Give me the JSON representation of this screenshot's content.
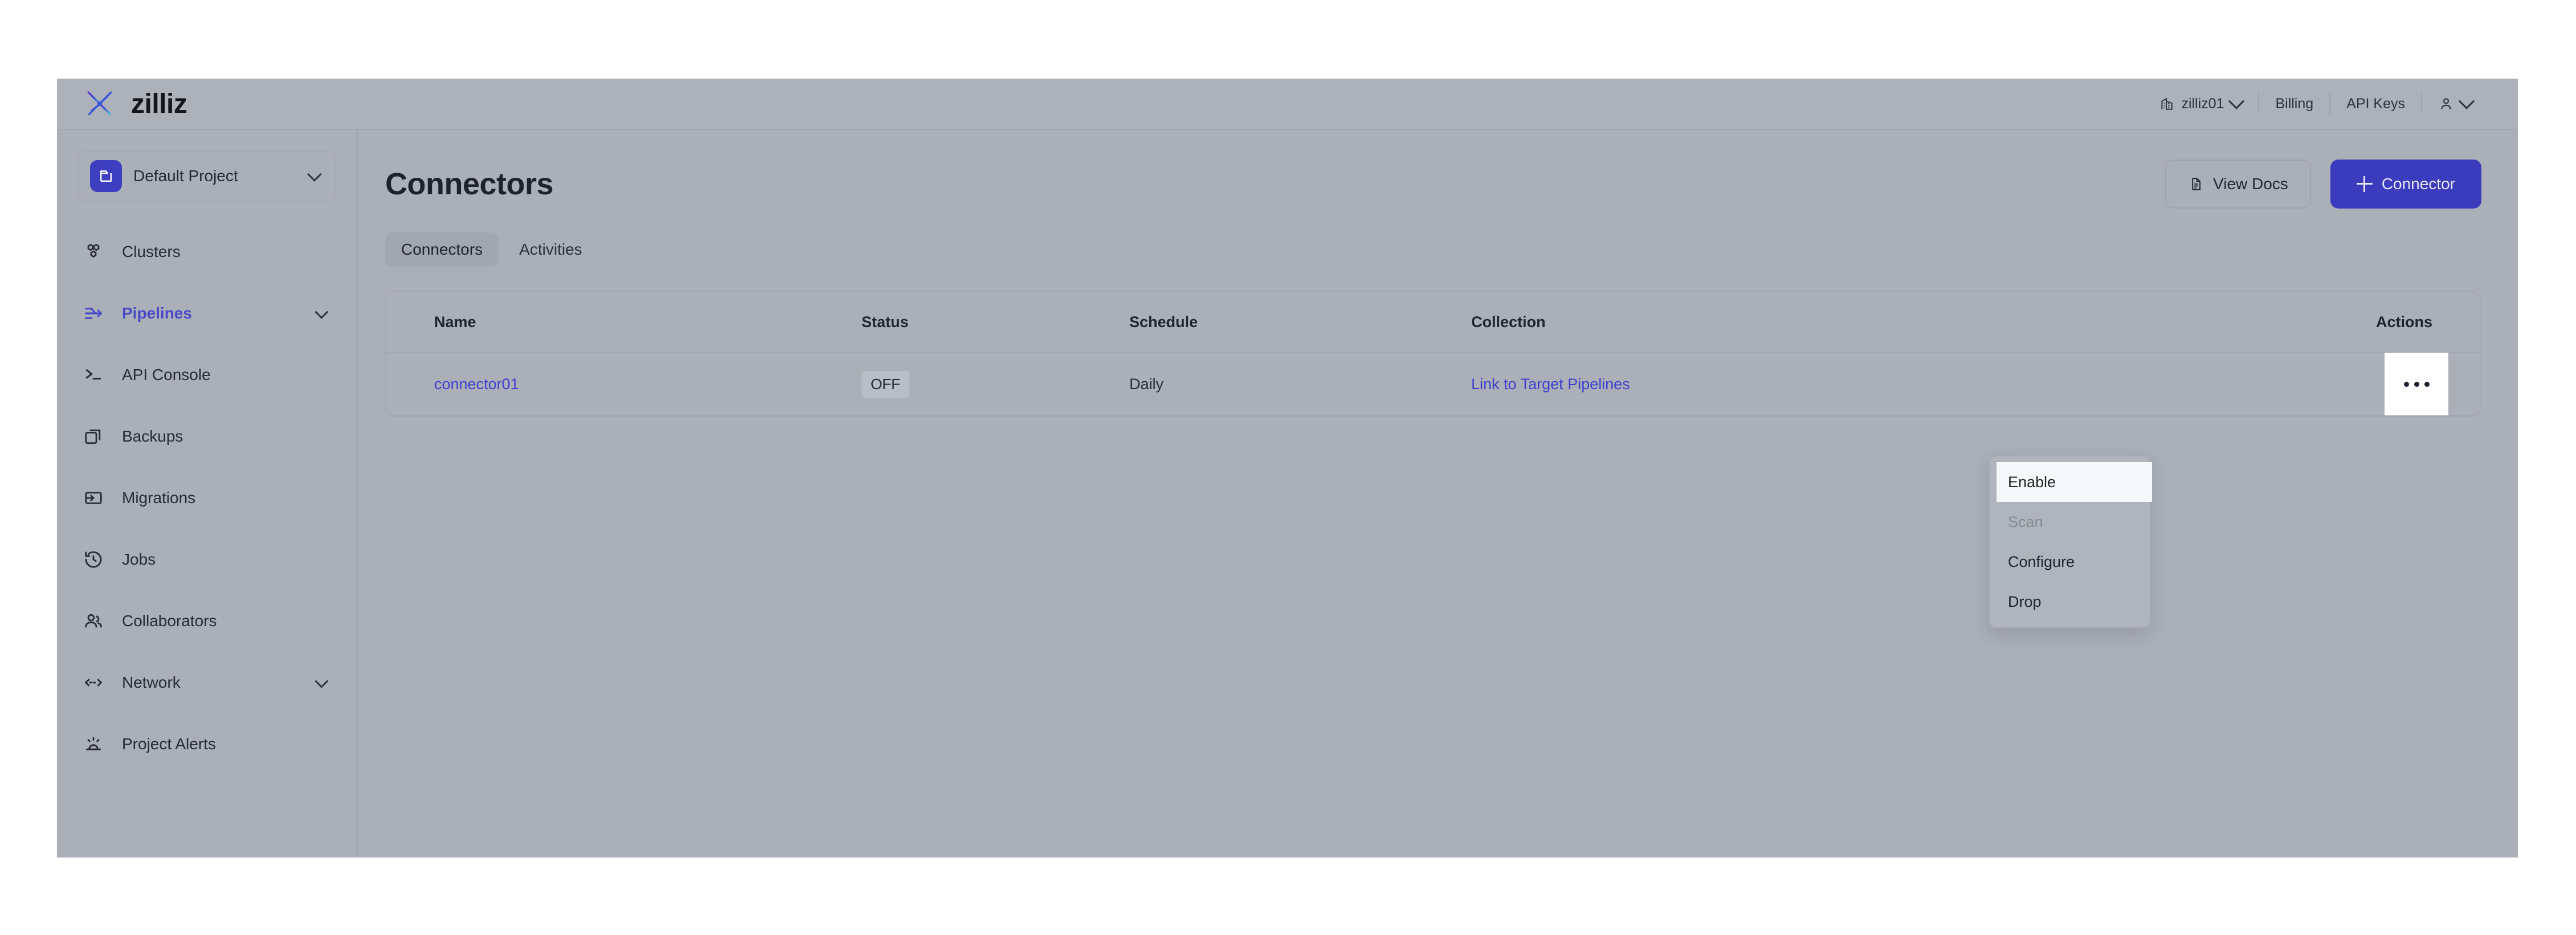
{
  "topbar": {
    "brand": "zilliz",
    "brand_logo_icon": "zilliz-starburst-icon",
    "org": {
      "icon": "building-icon",
      "label": "zilliz01",
      "chevron_icon": "chevron-down-icon"
    },
    "billing_label": "Billing",
    "api_keys_label": "API Keys",
    "account": {
      "icon": "user-icon",
      "chevron_icon": "chevron-down-icon"
    }
  },
  "sidebar": {
    "project": {
      "icon": "folder-icon",
      "label": "Default Project",
      "chevron_icon": "chevron-down-icon"
    },
    "items": [
      {
        "label": "Clusters",
        "icon": "honeycomb-icon",
        "active": false,
        "chevron": false
      },
      {
        "label": "Pipelines",
        "icon": "pipeline-arrow-icon",
        "active": true,
        "chevron": true
      },
      {
        "label": "API Console",
        "icon": "terminal-icon",
        "active": false,
        "chevron": false
      },
      {
        "label": "Backups",
        "icon": "copy-icon",
        "active": false,
        "chevron": false
      },
      {
        "label": "Migrations",
        "icon": "migration-icon",
        "active": false,
        "chevron": false
      },
      {
        "label": "Jobs",
        "icon": "clock-history-icon",
        "active": false,
        "chevron": false
      },
      {
        "label": "Collaborators",
        "icon": "users-icon",
        "active": false,
        "chevron": false
      },
      {
        "label": "Network",
        "icon": "network-arrows-icon",
        "active": false,
        "chevron": true
      },
      {
        "label": "Project Alerts",
        "icon": "siren-icon",
        "active": false,
        "chevron": false
      }
    ]
  },
  "page": {
    "title": "Connectors",
    "view_docs_label": "View Docs",
    "view_docs_icon": "document-icon",
    "new_connector_label": "Connector",
    "new_connector_icon": "plus-icon",
    "tabs": [
      {
        "label": "Connectors",
        "active": true
      },
      {
        "label": "Activities",
        "active": false
      }
    ]
  },
  "table": {
    "columns": [
      "Name",
      "Status",
      "Schedule",
      "Collection",
      "Actions"
    ],
    "rows": [
      {
        "name": "connector01",
        "status": "OFF",
        "schedule": "Daily",
        "collection": "Link to Target Pipelines",
        "actions_icon": "ellipsis-icon"
      }
    ]
  },
  "actions_menu": {
    "items": [
      {
        "label": "Enable",
        "state": "highlighted"
      },
      {
        "label": "Scan",
        "state": "disabled"
      },
      {
        "label": "Configure",
        "state": "normal"
      },
      {
        "label": "Drop",
        "state": "normal"
      }
    ]
  },
  "colors": {
    "accent": "#3b3bbd",
    "link": "#4040cf",
    "active_nav": "#4a4ac8",
    "app_bg": "#abafb8",
    "overlay_dim": "rgba(120,126,138,0.45)"
  }
}
